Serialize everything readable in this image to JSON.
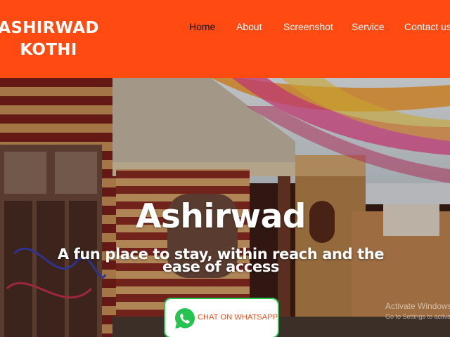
{
  "header": {
    "logo_line1": "ASHIRWAD",
    "logo_line2": "KOTHI",
    "nav": [
      {
        "label": "Home",
        "active": true
      },
      {
        "label": "About",
        "active": false
      },
      {
        "label": "Screenshot",
        "active": false
      },
      {
        "label": "Service",
        "active": false
      },
      {
        "label": "Contact us",
        "active": false
      }
    ]
  },
  "hero": {
    "title": "Ashirwad",
    "subtitle": "A fun place to stay, within reach and the ease of access",
    "whatsapp_label": "CHAT ON WHATSAPP"
  },
  "watermark": {
    "line1": "Activate Windows",
    "line2": "Go to Settings to activate Windows."
  },
  "colors": {
    "brand": "#ff4a12",
    "whatsapp": "#27c351",
    "nav_active": "#111111"
  }
}
